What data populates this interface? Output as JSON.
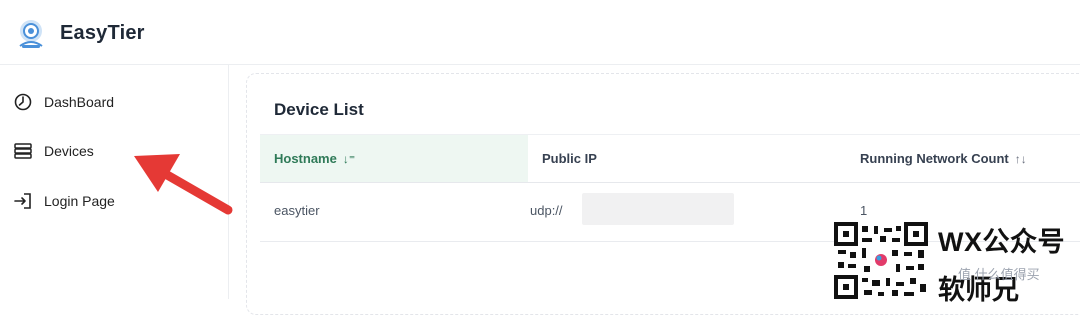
{
  "app": {
    "title": "EasyTier",
    "logo_icon": "easytier-logo-icon"
  },
  "sidebar": {
    "items": [
      {
        "label": "DashBoard",
        "icon": "dashboard-clock-icon"
      },
      {
        "label": "Devices",
        "icon": "server-list-icon"
      },
      {
        "label": "Login Page",
        "icon": "login-arrow-icon"
      }
    ]
  },
  "main": {
    "card_title": "Device List",
    "table": {
      "columns": [
        {
          "label": "Hostname",
          "sort": "↓⁼"
        },
        {
          "label": "Public IP",
          "sort": ""
        },
        {
          "label": "Running Network Count",
          "sort": "↑↓"
        }
      ],
      "rows": [
        {
          "hostname": "easytier",
          "public_ip": "udp://",
          "count": "1"
        }
      ]
    }
  },
  "annotation": {
    "arrow_color": "#e53935"
  },
  "watermark": {
    "line1": "WX公众号",
    "line2": "软师兄",
    "overlay": "值  什么值得买"
  },
  "colors": {
    "accent": "#2f7a58",
    "accent_bg": "#eef7f2"
  }
}
